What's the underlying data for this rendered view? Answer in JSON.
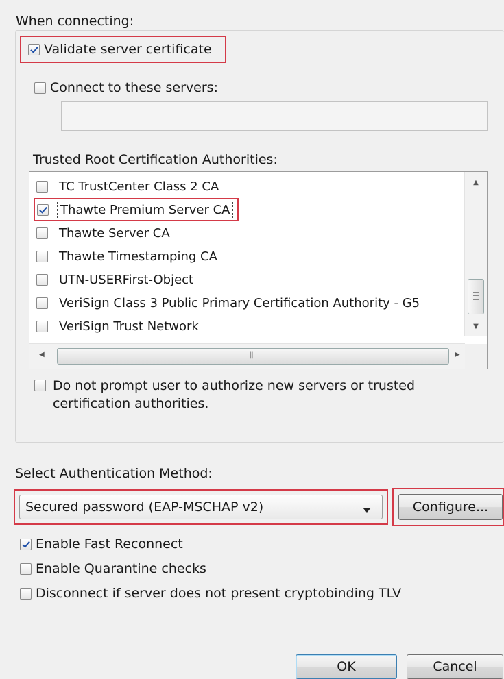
{
  "sections": {
    "when_connecting": "When connecting:",
    "trusted_root": "Trusted Root Certification Authorities:",
    "select_method": "Select Authentication Method:"
  },
  "options": {
    "validate_cert": {
      "label": "Validate server certificate",
      "checked": true
    },
    "connect_servers": {
      "label": "Connect to these servers:",
      "checked": false,
      "value": ""
    },
    "no_prompt": {
      "line1": "Do not prompt user to authorize new servers or trusted",
      "line2": "certification authorities.",
      "checked": false
    }
  },
  "ca_list": {
    "items": [
      {
        "label": "TC TrustCenter Class 2 CA",
        "checked": false
      },
      {
        "label": "Thawte Premium Server CA",
        "checked": true
      },
      {
        "label": "Thawte Server CA",
        "checked": false
      },
      {
        "label": "Thawte Timestamping CA",
        "checked": false
      },
      {
        "label": "UTN-USERFirst-Object",
        "checked": false
      },
      {
        "label": "VeriSign Class 3 Public Primary Certification Authority - G5",
        "checked": false
      },
      {
        "label": "VeriSign Trust Network",
        "checked": false
      }
    ]
  },
  "auth_method": {
    "selected": "Secured password (EAP-MSCHAP v2)"
  },
  "configure_button": "Configure...",
  "extra_options": [
    {
      "label": "Enable Fast Reconnect",
      "checked": true
    },
    {
      "label": "Enable Quarantine checks",
      "checked": false
    },
    {
      "label": "Disconnect if server does not present cryptobinding TLV",
      "checked": false
    }
  ],
  "buttons": {
    "ok": "OK",
    "cancel": "Cancel"
  },
  "colors": {
    "highlight": "#d43a48",
    "check": "#1e4fa8"
  },
  "icons": {
    "scroll_up": "triangle-up",
    "scroll_down": "triangle-down",
    "scroll_left": "triangle-left",
    "scroll_right": "triangle-right",
    "dropdown": "triangle-down"
  }
}
